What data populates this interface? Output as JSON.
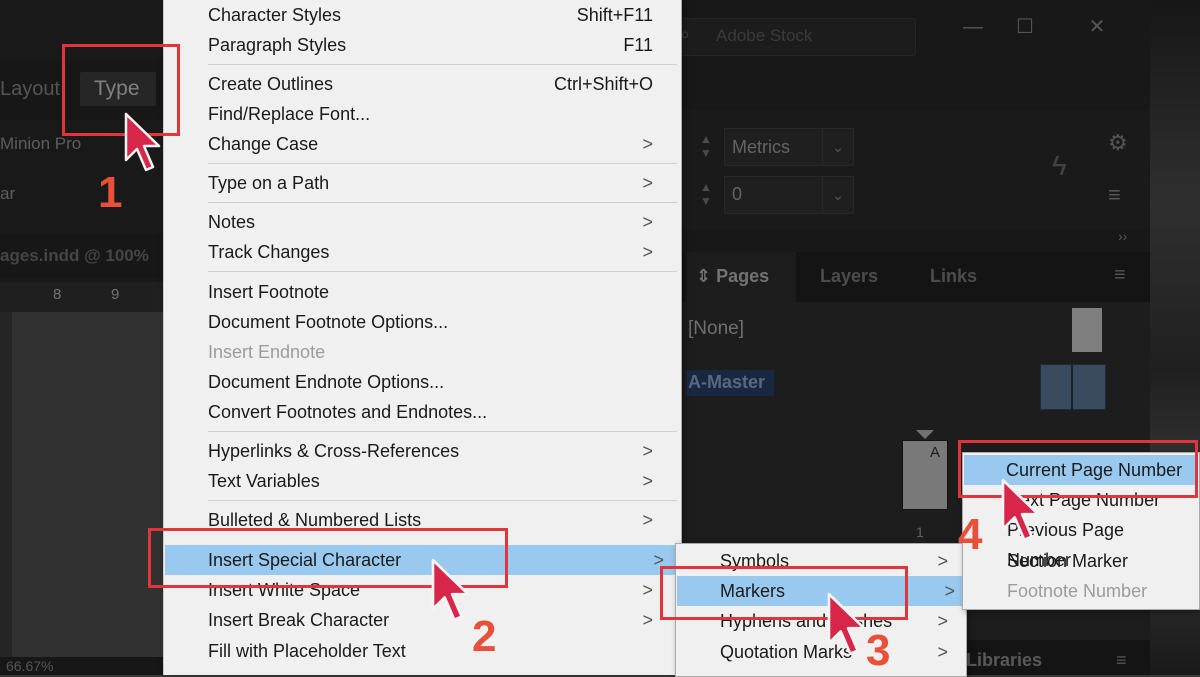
{
  "menubar": {
    "layout_label": "Layout",
    "type_label": "Type"
  },
  "control": {
    "font_name": "Minion Pro",
    "font_style": "ar",
    "kerning": "Metrics",
    "tracking": "0"
  },
  "document": {
    "tab_label": "ages.indd @ 100%",
    "ruler_8": "8",
    "ruler_9": "9",
    "zoom": "66.67%"
  },
  "search": {
    "placeholder": "Adobe Stock"
  },
  "window_buttons": [
    "—",
    "☐",
    "✕"
  ],
  "panel_tabs": [
    "Pages",
    "Layers",
    "Links"
  ],
  "pages_panel": {
    "none_label": "[None]",
    "master_label": "A-Master",
    "page_letter": "A",
    "page_number": "1"
  },
  "libraries_label": "Libraries",
  "type_menu": {
    "items": [
      {
        "label": "Character Styles",
        "shortcut": "Shift+F11"
      },
      {
        "label": "Paragraph Styles",
        "shortcut": "F11"
      },
      {
        "label": "Create Outlines",
        "shortcut": "Ctrl+Shift+O"
      },
      {
        "label": "Find/Replace Font..."
      },
      {
        "label": "Change Case",
        "arrow": ">"
      },
      {
        "label": "Type on a Path",
        "arrow": ">"
      },
      {
        "label": "Notes",
        "arrow": ">"
      },
      {
        "label": "Track Changes",
        "arrow": ">"
      },
      {
        "label": "Insert Footnote"
      },
      {
        "label": "Document Footnote Options..."
      },
      {
        "label": "Insert Endnote"
      },
      {
        "label": "Document Endnote Options..."
      },
      {
        "label": "Convert Footnotes and Endnotes..."
      },
      {
        "label": "Hyperlinks & Cross-References",
        "arrow": ">"
      },
      {
        "label": "Text Variables",
        "arrow": ">"
      },
      {
        "label": "Bulleted & Numbered Lists",
        "arrow": ">"
      },
      {
        "label": "Insert Special Character",
        "arrow": ">"
      },
      {
        "label": "Insert White Space",
        "arrow": ">"
      },
      {
        "label": "Insert Break Character",
        "arrow": ">"
      },
      {
        "label": "Fill with Placeholder Text"
      }
    ]
  },
  "special_char_menu": {
    "items": [
      {
        "label": "Symbols",
        "arrow": ">"
      },
      {
        "label": "Markers",
        "arrow": ">"
      },
      {
        "label": "Hyphens and Dashes",
        "arrow": ">"
      },
      {
        "label": "Quotation Marks",
        "arrow": ">"
      }
    ]
  },
  "markers_menu": {
    "items": [
      {
        "label": "Current Page Number"
      },
      {
        "label": "Next Page Number"
      },
      {
        "label": "Previous Page Number"
      },
      {
        "label": "Section Marker"
      },
      {
        "label": "Footnote Number"
      }
    ]
  },
  "steps": [
    "1",
    "2",
    "3",
    "4"
  ],
  "colors": {
    "highlight": "#99c9ef",
    "annotation": "#e2353b",
    "step_number": "#e8503a"
  }
}
